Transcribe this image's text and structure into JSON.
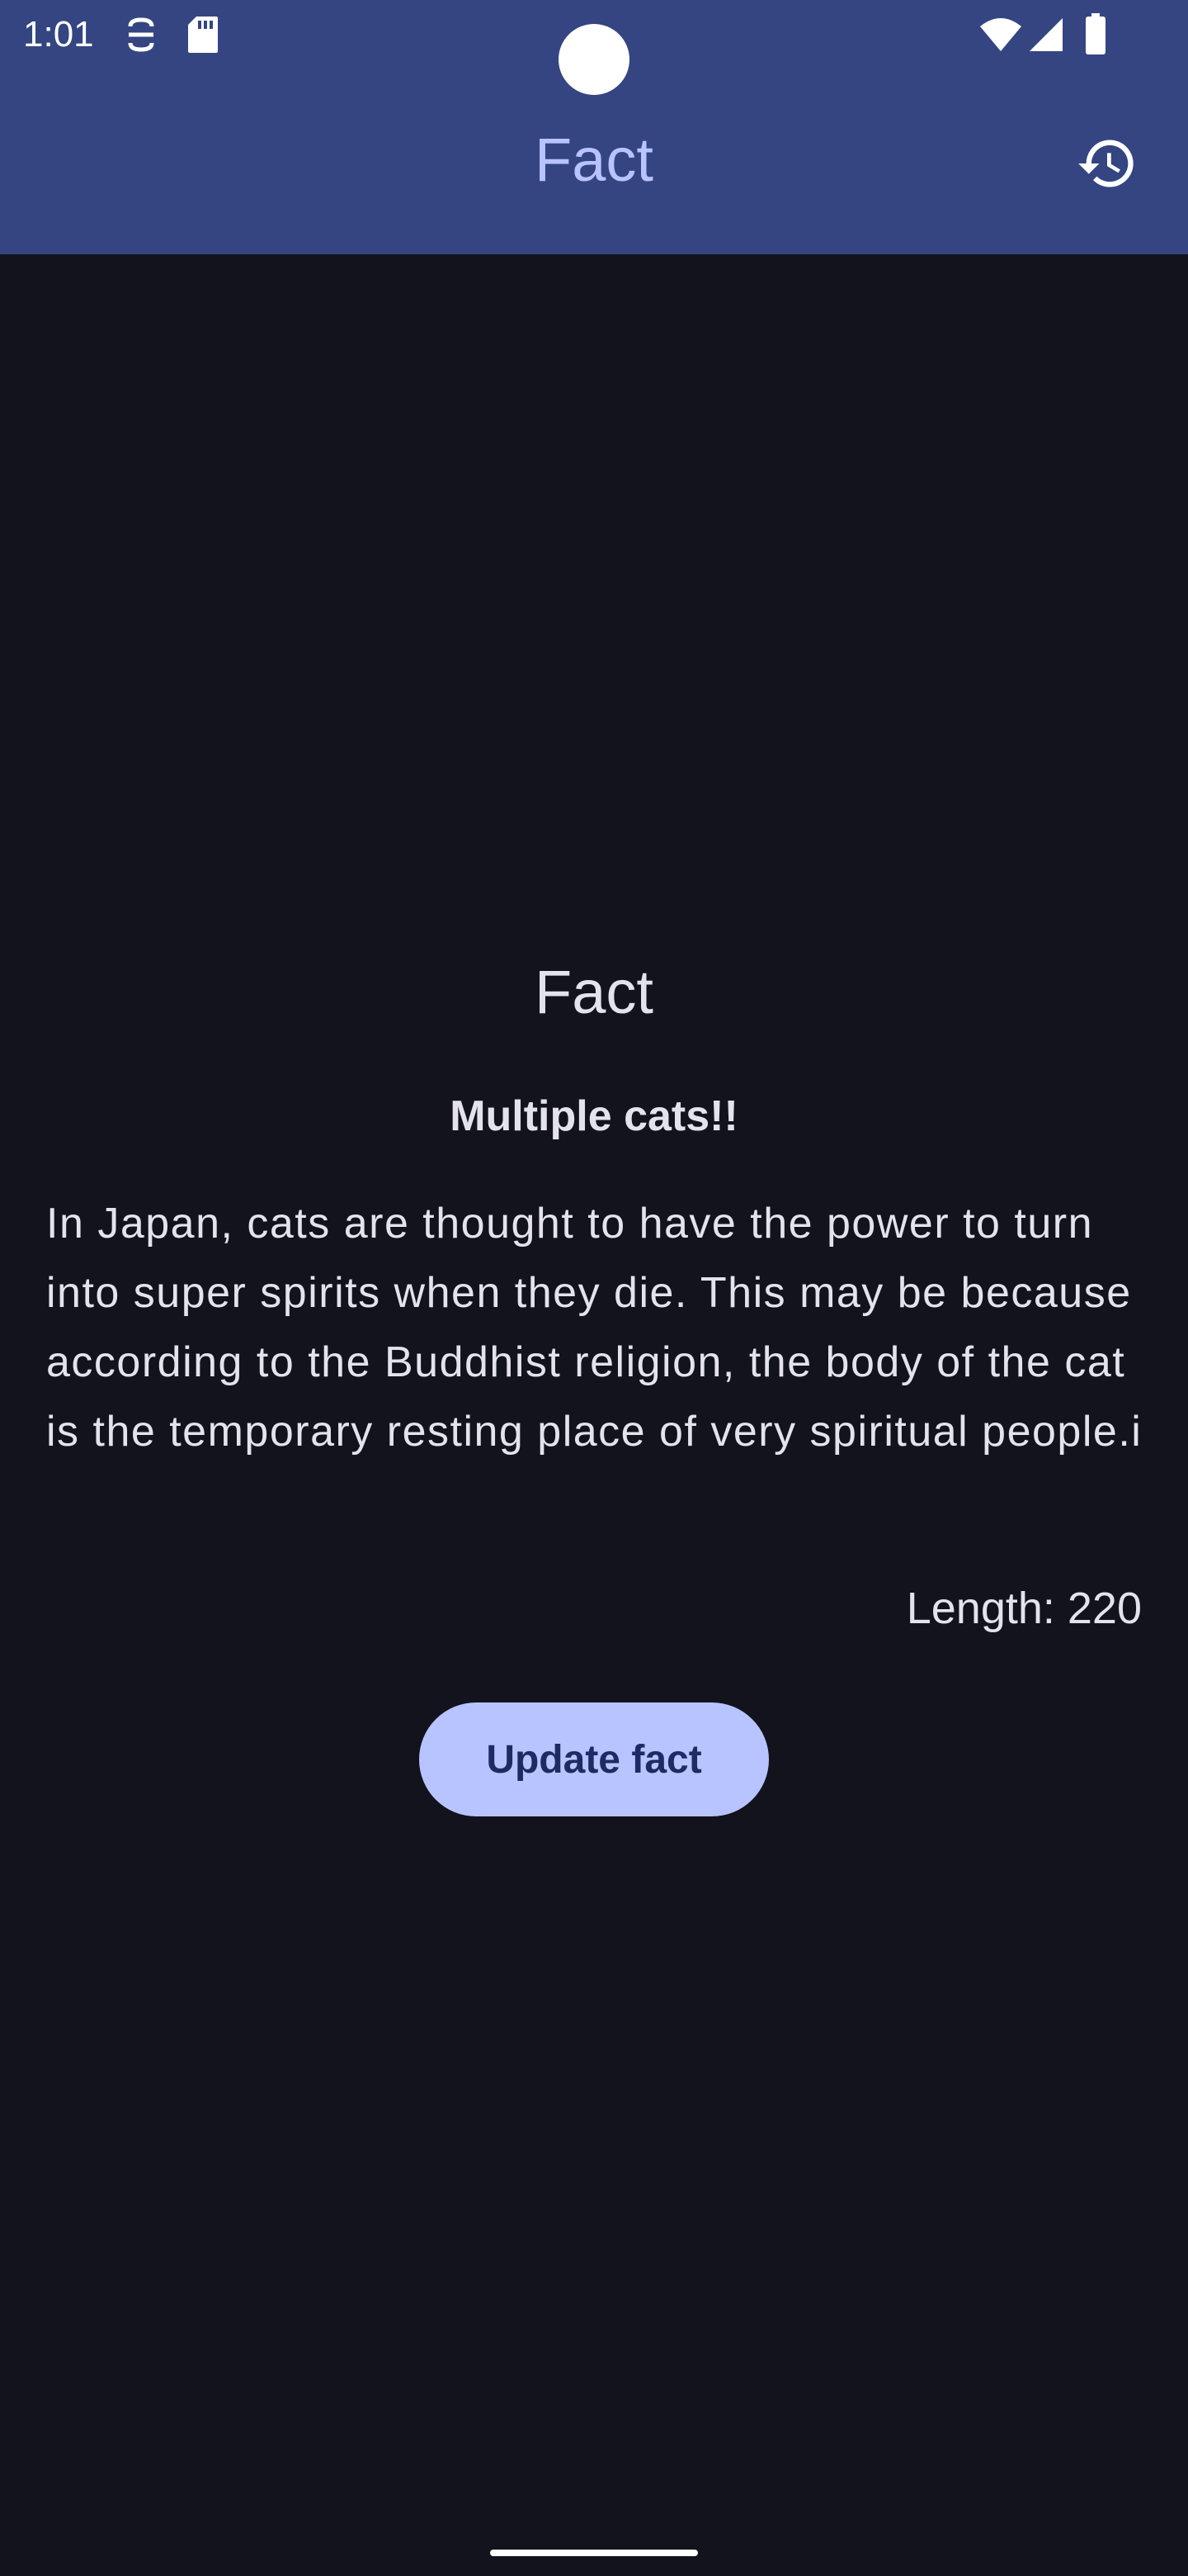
{
  "status_bar": {
    "time": "1:01",
    "icons": [
      "sync-icon",
      "sd-card-icon",
      "wifi-icon",
      "signal-icon",
      "battery-icon"
    ]
  },
  "app_bar": {
    "title": "Fact",
    "action_icon": "history-icon"
  },
  "content": {
    "heading": "Fact",
    "subtitle": "Multiple cats!!",
    "fact_text": "In Japan, cats are thought to have the power to turn into super spirits when they die. This may be because according to the Buddhist religion, the body of the cat is the temporary resting place of very spiritual people.i",
    "length_label": "Length: 220",
    "update_button_label": "Update fact"
  },
  "colors": {
    "app_bar_bg": "#344582",
    "screen_bg": "#12131c",
    "accent": "#b8c4ff",
    "button_text": "#1c2b63",
    "text": "#e4e2ec"
  }
}
